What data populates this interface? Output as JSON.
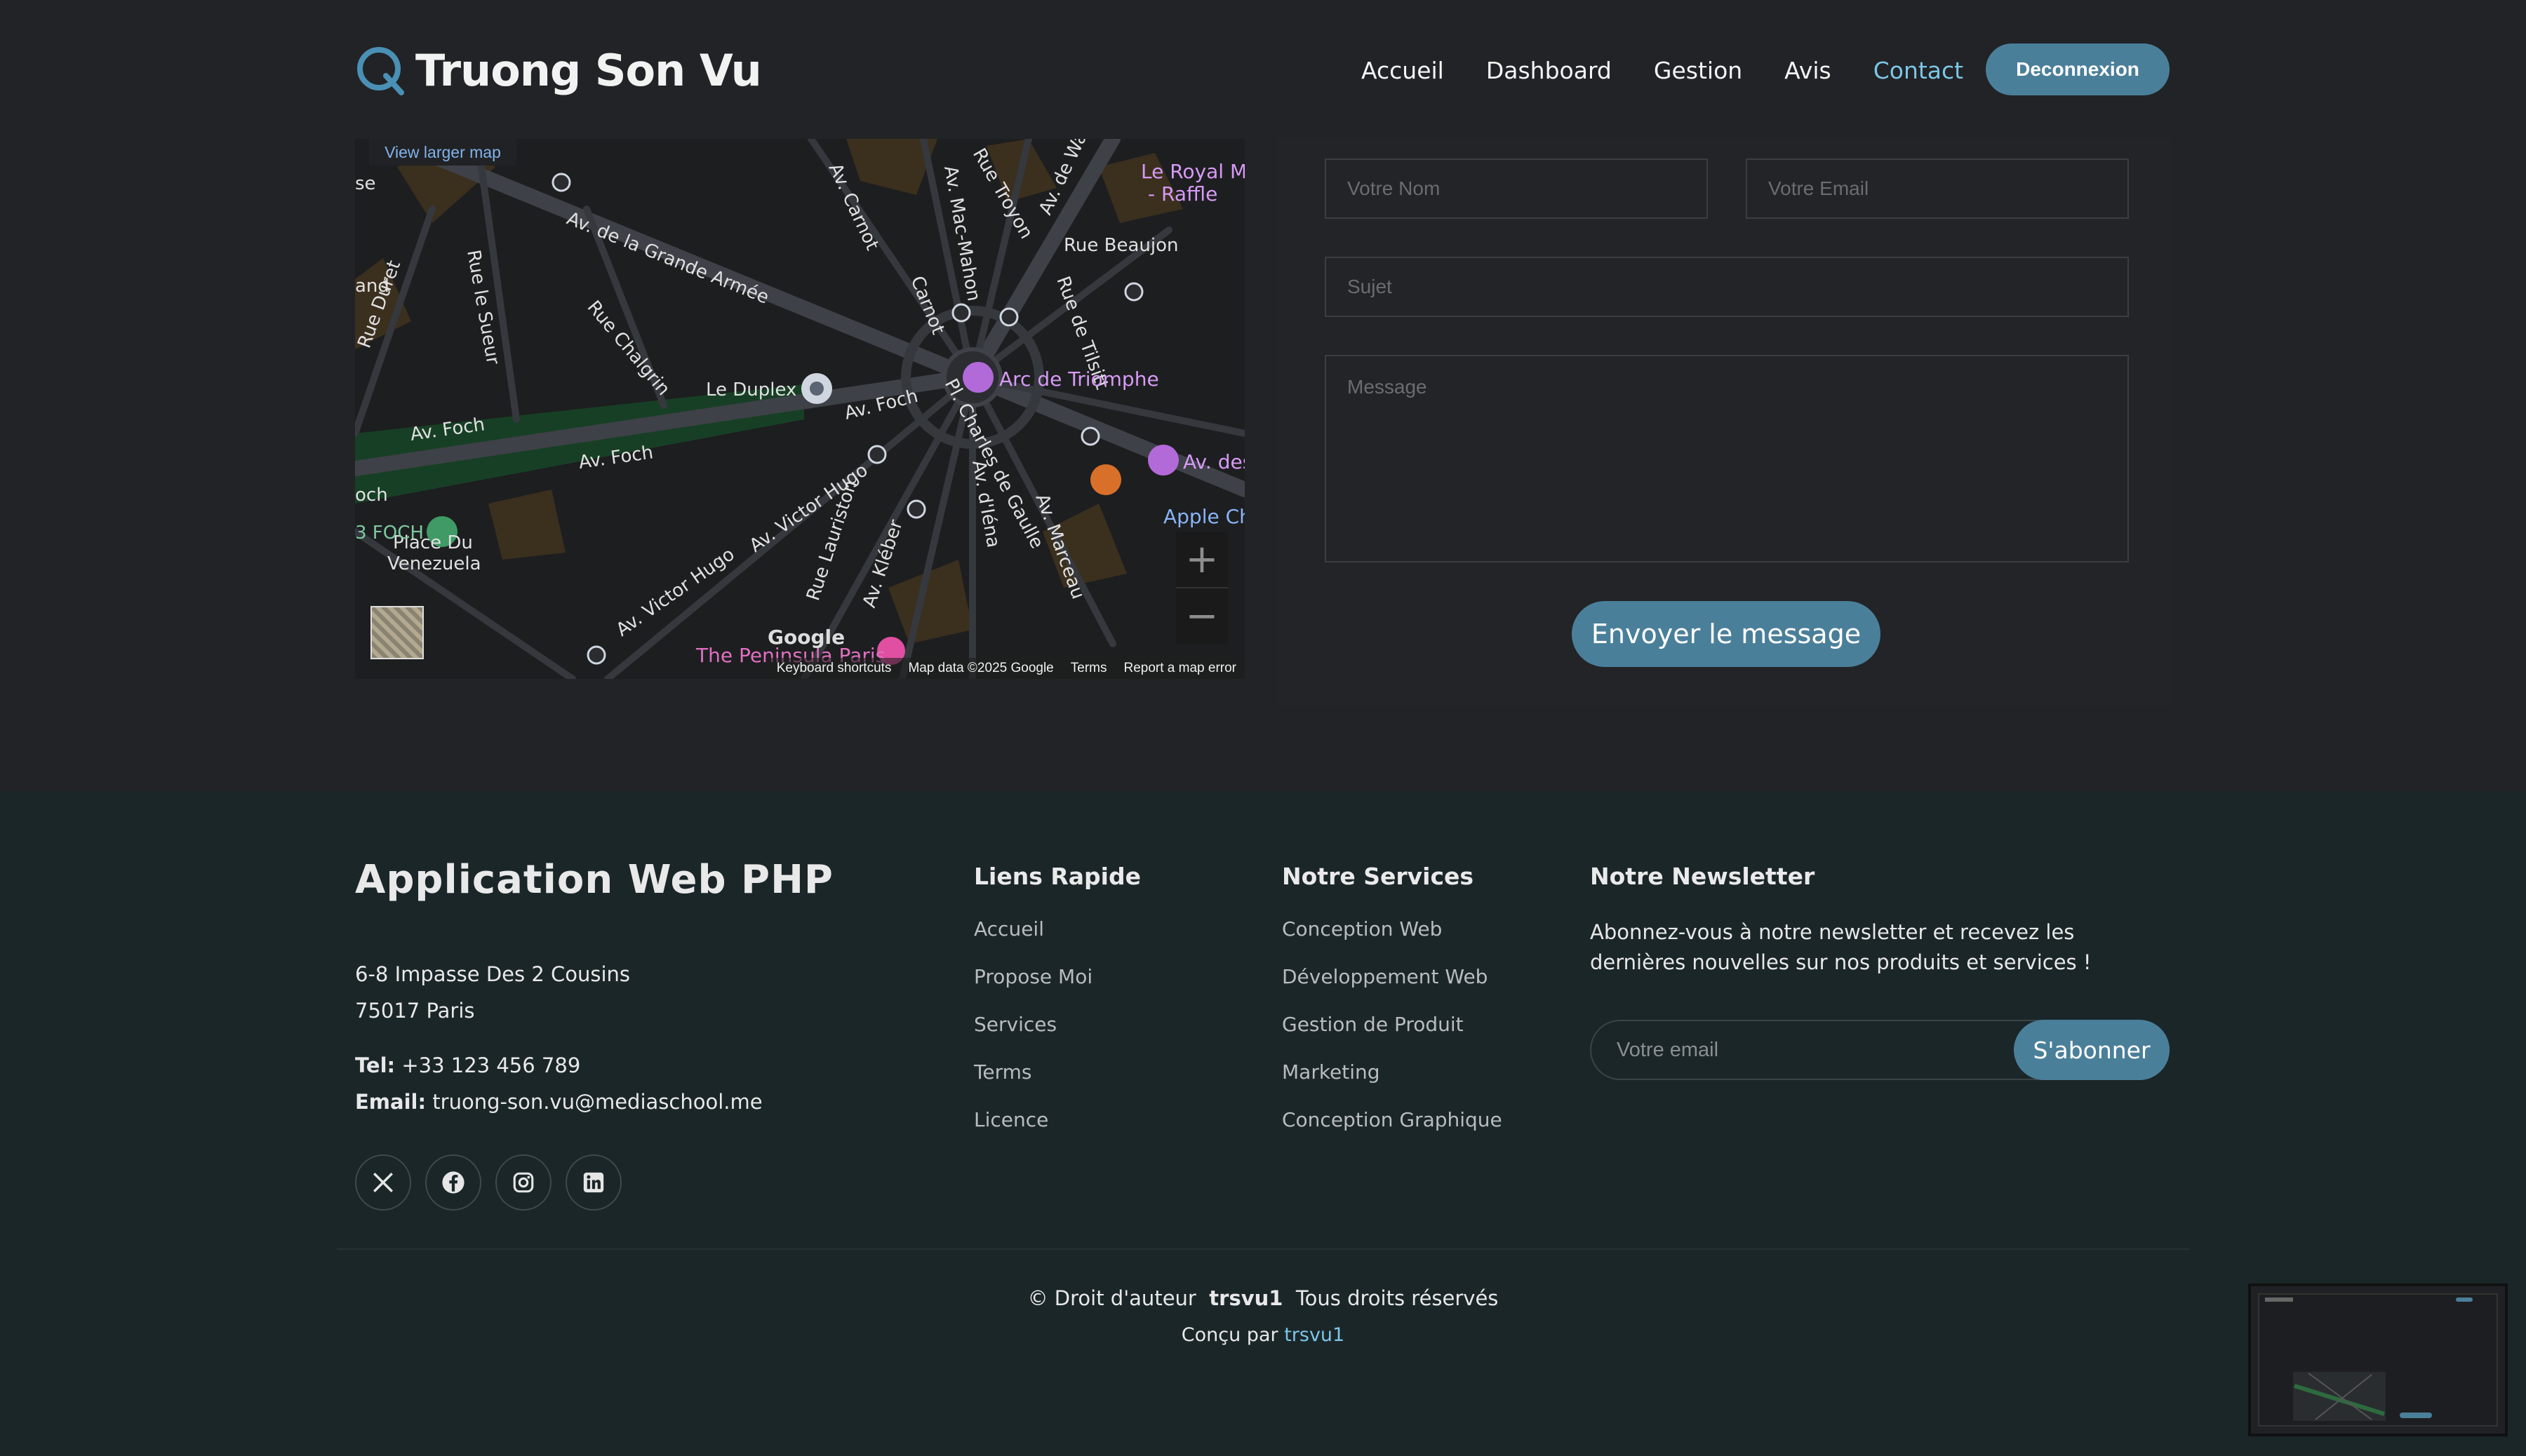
{
  "header": {
    "brand": "Truong Son Vu",
    "nav": [
      "Accueil",
      "Dashboard",
      "Gestion",
      "Avis",
      "Contact"
    ],
    "logout": "Deconnexion"
  },
  "map": {
    "larger_map": "View larger map",
    "footer": [
      "Keyboard shortcuts",
      "Map data ©2025 Google",
      "Terms",
      "Report a map error"
    ],
    "labels": {
      "grande_armee": "Av. de la Grande Armée",
      "carnot": "Av. Carnot",
      "mac_mahon": "Av. Mac-Mahon",
      "troyon": "Rue Troyon",
      "wagram": "Av. de Wagr",
      "royal": "Le Royal Mo",
      "raffles": "- Raffle",
      "beaujon": "Rue Beaujon",
      "tilsitt": "Rue de Tilsitt",
      "carnot2": "Carnot",
      "duret": "Rue Duret",
      "sueur": "Rue le Sueur",
      "chalgrin": "Rue Chalgrin",
      "duplex": "Le Duplex",
      "foch1": "Av. Foch",
      "foch2": "Av. Foch",
      "foch3": "Av. Foch",
      "arc": "Arc de Triomphe",
      "charles": "Pl. Charles de Gaulle",
      "iena": "Av. d'Iéna",
      "marceau": "Av. Marceau",
      "des": "Av. des",
      "apple": "Apple Cha",
      "victor1": "Av. Victor Hugo",
      "victor2": "Av. Victor Hugo",
      "lauriston": "Rue Lauriston",
      "kleber": "Av. Kléber",
      "foch_metro": "3 FOCH",
      "place_du": "Place Du",
      "venezuela": "Venezuela",
      "peninsula": "The Peninsula Paris",
      "se": "se",
      "and": "and",
      "och": "och",
      "google": "Google"
    }
  },
  "form": {
    "name_placeholder": "Votre Nom",
    "email_placeholder": "Votre Email",
    "subject_placeholder": "Sujet",
    "message_placeholder": "Message",
    "send": "Envoyer le message"
  },
  "footer": {
    "title": "Application Web PHP",
    "address1": "6-8 Impasse Des 2 Cousins",
    "address2": "75017 Paris",
    "tel_label": "Tel:",
    "tel": "+33 123 456 789",
    "email_label": "Email:",
    "email": "truong-son.vu@mediaschool.me",
    "socials": [
      "x-icon",
      "facebook-icon",
      "instagram-icon",
      "linkedin-icon"
    ],
    "quick_links_title": "Liens Rapide",
    "quick_links": [
      "Accueil",
      "Propose Moi",
      "Services",
      "Terms",
      "Licence"
    ],
    "services_title": "Notre Services",
    "services": [
      "Conception Web",
      "Développement Web",
      "Gestion de Produit",
      "Marketing",
      "Conception Graphique"
    ],
    "newsletter_title": "Notre Newsletter",
    "newsletter_text": "Abonnez-vous à notre newsletter et recevez les dernières nouvelles sur nos produits et services !",
    "newsletter_placeholder": "Votre email",
    "subscribe": "S'abonner",
    "copyright_prefix": "© Droit d'auteur",
    "copyright_name": "trsvu1",
    "copyright_suffix": "Tous droits réservés",
    "designed_prefix": "Conçu par",
    "designed_name": "trsvu1"
  },
  "colors": {
    "accent": "#4a7f9a",
    "link": "#7cc6e6",
    "footer_bg": "#1b2629",
    "page_bg": "#222326"
  }
}
